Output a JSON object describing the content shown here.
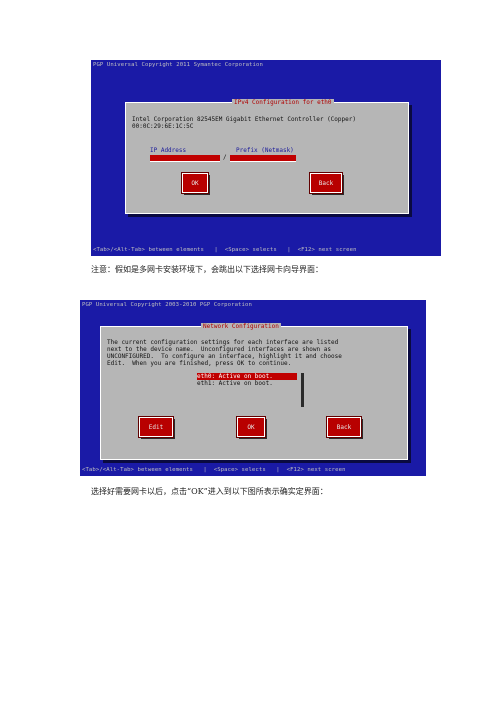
{
  "screen1": {
    "header": "PGP Universal Copyright 2011 Symantec Corporation",
    "dialog_title": "IPv4 Configuration for eth0",
    "device_line1": "Intel Corporation 82545EM Gigabit Ethernet Controller (Copper)",
    "device_line2": "00:0C:29:6E:1C:5C",
    "ip_label": "IP Address",
    "prefix_label": "Prefix (Netmask)",
    "separator": "/",
    "ok_label": "OK",
    "back_label": "Back",
    "footer": "<Tab>/<Alt-Tab> between elements   |  <Space> selects   |  <F12> next screen"
  },
  "caption1": "注意：假如是多网卡安装环境下，会跳出以下选择网卡向导界面：",
  "screen2": {
    "header": "PGP Universal Copyright 2003-2010 PGP Corporation",
    "dialog_title": "Network Configuration",
    "body_lines": [
      "The current configuration settings for each interface are listed",
      "next to the device name.  Unconfigured interfaces are shown as",
      "UNCONFIGURED.  To configure an interface, highlight it and choose",
      "Edit.  When you are finished, press OK to continue."
    ],
    "list": [
      {
        "label": "eth0: Active on boot.",
        "selected": true
      },
      {
        "label": "eth1: Active on boot.",
        "selected": false
      }
    ],
    "edit_label": "Edit",
    "ok_label": "OK",
    "back_label": "Back",
    "footer": "<Tab>/<Alt-Tab> between elements   |  <Space> selects   |  <F12> next screen"
  },
  "caption2": "选择好需要网卡以后，点击“OK”进入到以下图所表示确实定界面："
}
